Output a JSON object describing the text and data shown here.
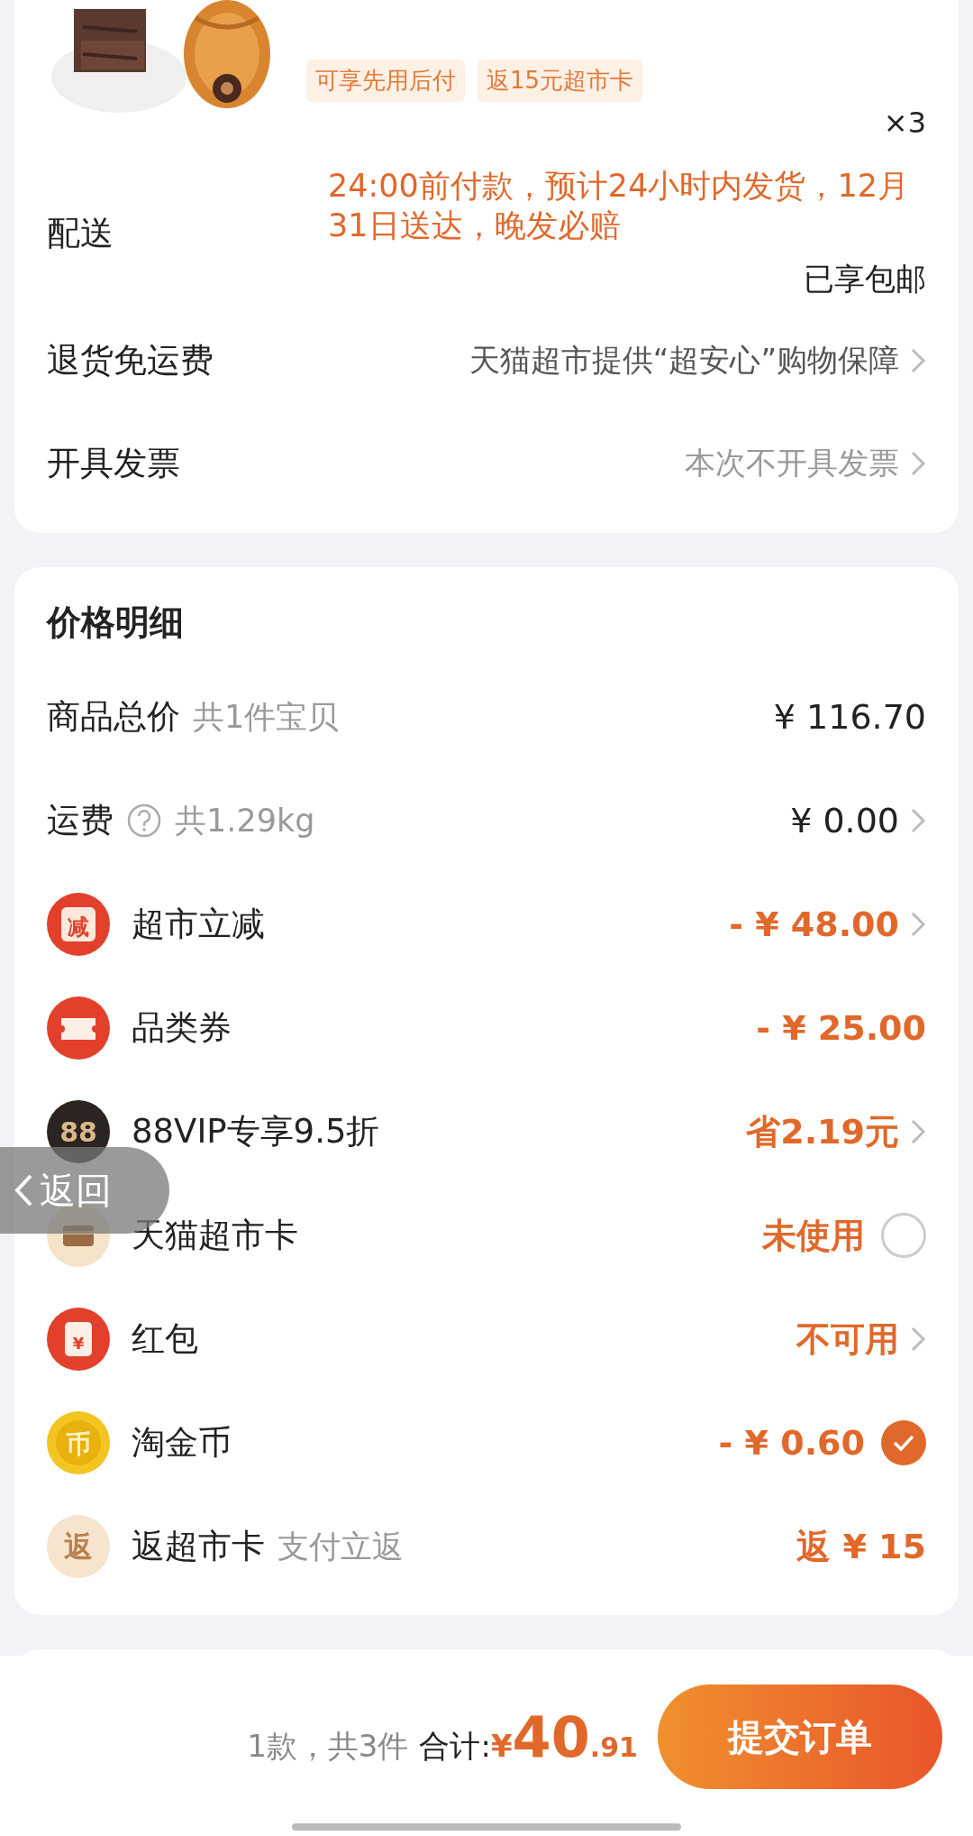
{
  "product": {
    "image": {
      "kind": "picture"
    },
    "tags": [
      "可享先用后付",
      "返15元超市卡"
    ],
    "quantity": "×3"
  },
  "order_rows": [
    {
      "kind": "delivery",
      "label": "配送",
      "detail": "24:00前付款，预计24小时内发货，12月31日送达，晚发必赔",
      "note": "已享包邮"
    },
    {
      "kind": "link",
      "label": "退货免运费",
      "value": "天猫超市提供“超安心”购物保障",
      "muted": false
    },
    {
      "kind": "link",
      "label": "开具发票",
      "value": "本次不开具发票",
      "muted": true
    }
  ],
  "price_detail": {
    "title": "价格明细",
    "rows": [
      {
        "kind": "plain",
        "label": "商品总价",
        "note": "共1件宝贝",
        "value": "¥ 116.70",
        "highlight": false,
        "chevron": false
      },
      {
        "kind": "help",
        "label": "运费",
        "note": "共1.29kg",
        "value": "¥ 0.00",
        "highlight": false,
        "chevron": true
      },
      {
        "kind": "discount",
        "badge": "减",
        "label": "超市立减",
        "value": "- ¥ 48.00",
        "highlight": true,
        "chevron": true
      },
      {
        "kind": "ticket",
        "label": "品类券",
        "value": "- ¥ 25.00",
        "highlight": true,
        "chevron": false
      },
      {
        "kind": "vip",
        "badge": "88",
        "label": "88VIP专享9.5折",
        "value": "省2.19元",
        "highlight": true,
        "chevron": true
      },
      {
        "kind": "card",
        "label": "天猫超市卡",
        "value": "未使用",
        "highlight": true,
        "checked": false
      },
      {
        "kind": "packet",
        "badge": "¥",
        "label": "红包",
        "value": "不可用",
        "highlight": true,
        "chevron": true
      },
      {
        "kind": "coin",
        "badge": "币",
        "label": "淘金币",
        "value": "- ¥ 0.60",
        "highlight": true,
        "checked": true
      },
      {
        "kind": "rebate",
        "badge": "返",
        "label": "返超市卡",
        "note": "支付立返",
        "value": "返 ¥ 15",
        "highlight": true,
        "chevron": false
      }
    ]
  },
  "back_button": {
    "label": "返回"
  },
  "footer": {
    "count": "1款，共3件",
    "total_label": "合计:",
    "currency": "¥",
    "integer": "40",
    "decimal": ".91",
    "submit": "提交订单"
  }
}
